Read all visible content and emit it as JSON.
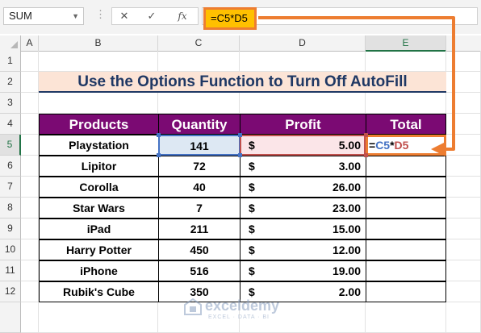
{
  "formula_bar": {
    "name_box": "SUM",
    "cancel_glyph": "✕",
    "enter_glyph": "✓",
    "fx_glyph": "fx",
    "formula": "=C5*D5"
  },
  "grid": {
    "columns": [
      "A",
      "B",
      "C",
      "D",
      "E"
    ],
    "rows": [
      "1",
      "2",
      "3",
      "4",
      "5",
      "6",
      "7",
      "8",
      "9",
      "10",
      "11",
      "12"
    ]
  },
  "title": "Use the Options Function to Turn Off AutoFill",
  "table": {
    "headers": [
      "Products",
      "Quantity",
      "Profit",
      "Total"
    ],
    "currency": "$",
    "rows": [
      {
        "product": "Playstation",
        "quantity": "141",
        "profit": "5.00"
      },
      {
        "product": "Lipitor",
        "quantity": "72",
        "profit": "3.00"
      },
      {
        "product": "Corolla",
        "quantity": "40",
        "profit": "26.00"
      },
      {
        "product": "Star Wars",
        "quantity": "7",
        "profit": "23.00"
      },
      {
        "product": "iPad",
        "quantity": "211",
        "profit": "15.00"
      },
      {
        "product": "Harry Potter",
        "quantity": "450",
        "profit": "12.00"
      },
      {
        "product": "iPhone",
        "quantity": "516",
        "profit": "19.00"
      },
      {
        "product": "Rubik's Cube",
        "quantity": "350",
        "profit": "2.00"
      }
    ],
    "editing_cell": {
      "prefix": "=",
      "ref1": "C5",
      "op": "*",
      "ref2": "D5"
    }
  },
  "watermark": {
    "name": "exceldemy",
    "tagline": "EXCEL · DATA · BI"
  },
  "colors": {
    "header_bg": "#7b0a73",
    "title_bg": "#fce4d6",
    "accent_orange": "#ed7d31",
    "formula_yellow": "#ffc000"
  }
}
